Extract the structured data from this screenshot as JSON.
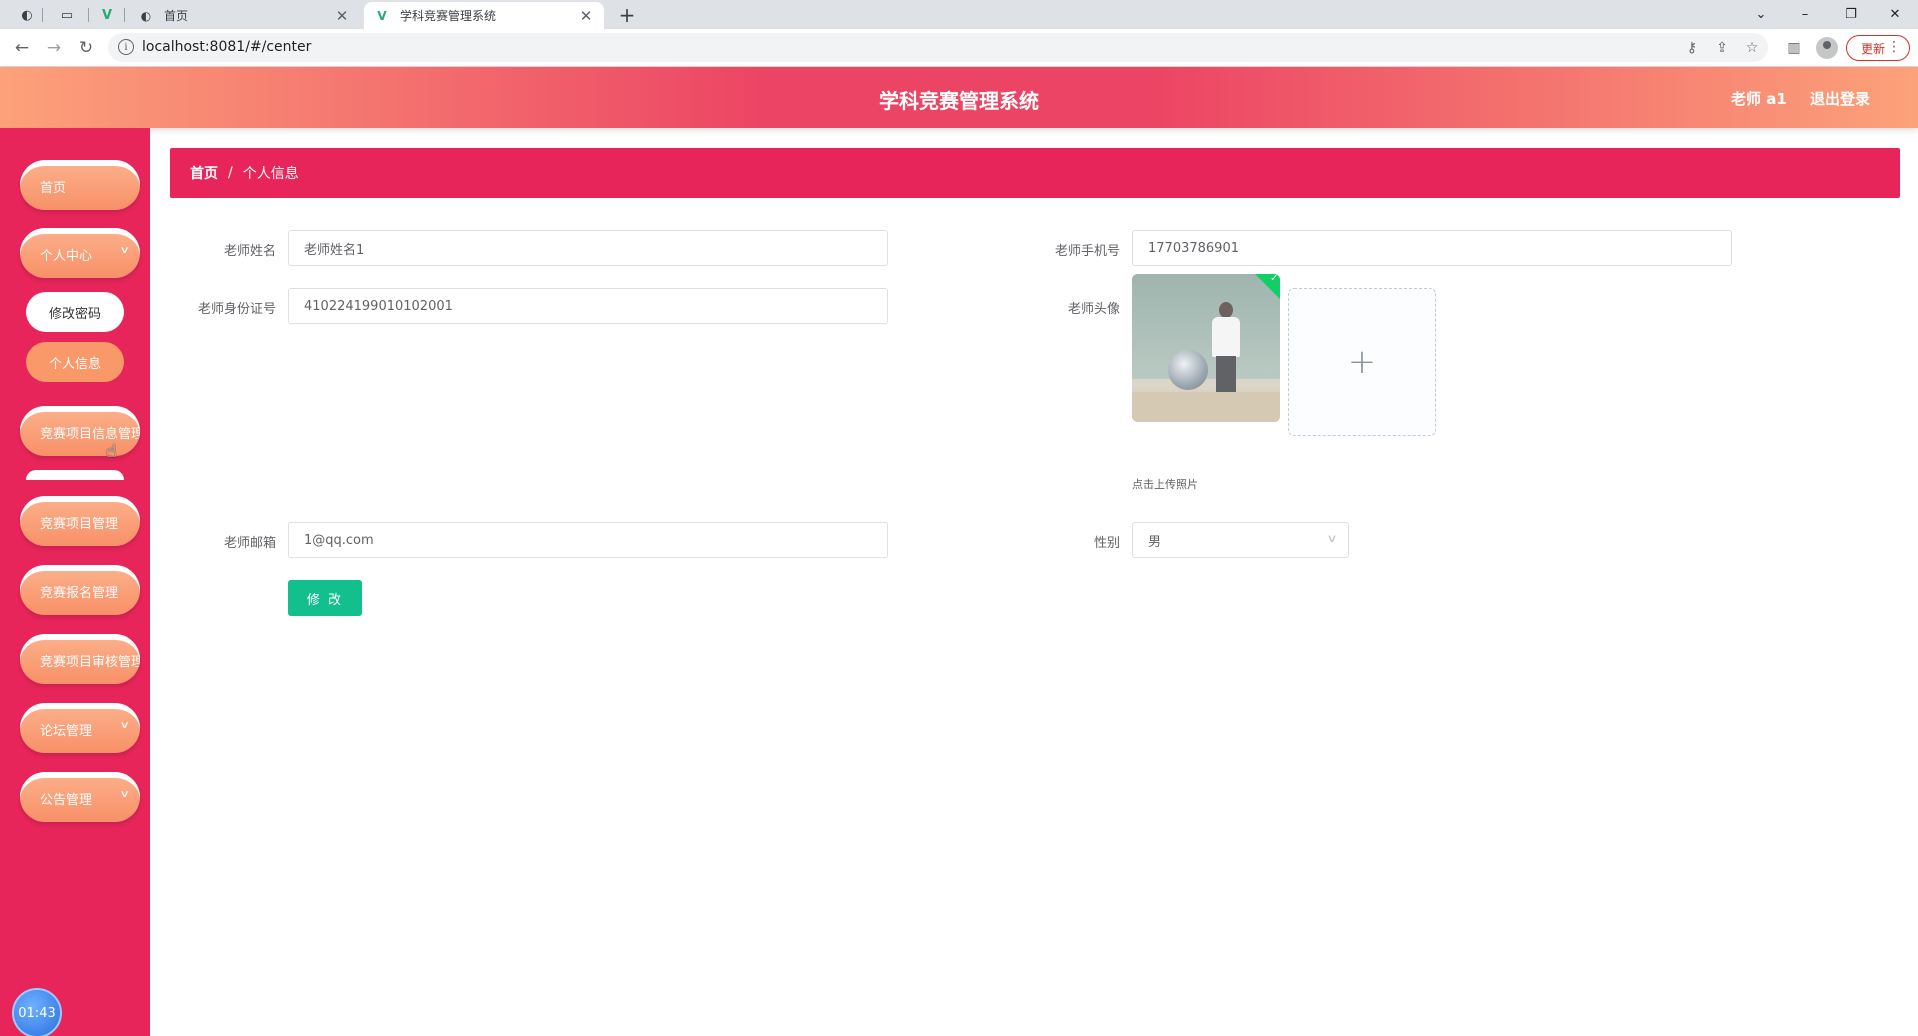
{
  "browser": {
    "tabs": [
      {
        "title": "首页",
        "close": "✕"
      },
      {
        "title": "学科竞赛管理系统",
        "close": "✕"
      }
    ],
    "new_tab": "+",
    "url": "localhost:8081/#/center",
    "update_label": "更新",
    "window_controls": {
      "minimize": "–",
      "restore": "❐",
      "close": "✕"
    }
  },
  "header": {
    "title": "学科竞赛管理系统",
    "user": "老师 a1",
    "logout": "退出登录"
  },
  "sidebar": {
    "items": [
      {
        "label": "首页"
      },
      {
        "label": "个人中心",
        "expanded": true
      },
      {
        "label": "竞赛项目信息管理"
      },
      {
        "label": "竞赛项目管理"
      },
      {
        "label": "竞赛报名管理"
      },
      {
        "label": "竞赛项目审核管理"
      },
      {
        "label": "论坛管理"
      },
      {
        "label": "公告管理"
      }
    ],
    "sub_items": [
      {
        "label": "修改密码"
      },
      {
        "label": "个人信息"
      }
    ],
    "timer": "01:43"
  },
  "breadcrumb": {
    "home": "首页",
    "separator": "/",
    "current": "个人信息"
  },
  "form": {
    "name": {
      "label": "老师姓名",
      "value": "老师姓名1"
    },
    "phone": {
      "label": "老师手机号",
      "value": "17703786901"
    },
    "idcard": {
      "label": "老师身份证号",
      "value": "410224199010102001"
    },
    "avatar": {
      "label": "老师头像",
      "add": "+",
      "tip": "点击上传照片"
    },
    "email": {
      "label": "老师邮箱",
      "value": "1@qq.com"
    },
    "gender": {
      "label": "性别",
      "value": "男"
    },
    "submit": "修 改"
  },
  "colors": {
    "primary": "#e8255a",
    "pill": "#f99868",
    "submit": "#13c08d"
  }
}
